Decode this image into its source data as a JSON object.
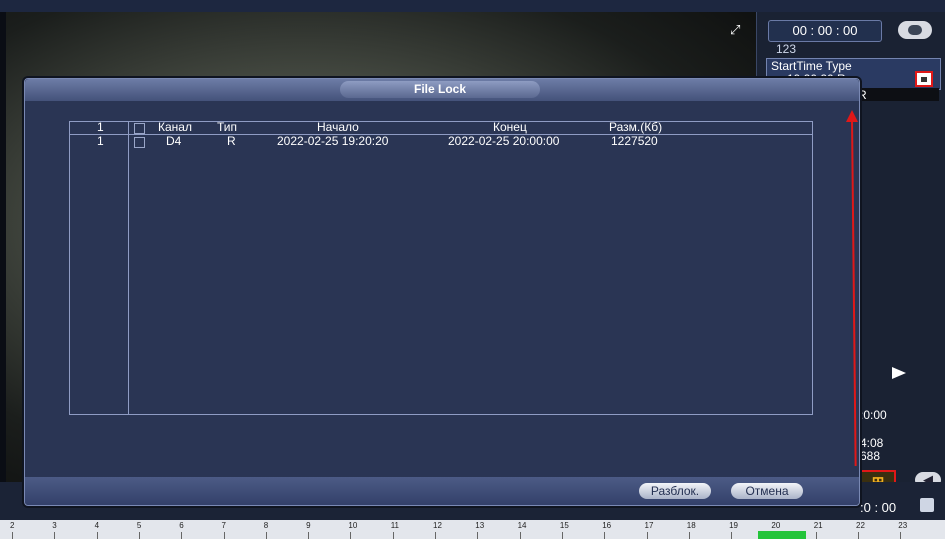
{
  "dialog": {
    "title": "File Lock",
    "table": {
      "index_header": "1",
      "columns": [
        "Канал",
        "Тип",
        "Начало",
        "Конец",
        "Разм.(Кб)"
      ],
      "rows": [
        {
          "index": "1",
          "channel": "D4",
          "type": "R",
          "start": "2022-02-25 19:20:20",
          "end": "2022-02-25 20:00:00",
          "size": "1227520"
        }
      ]
    },
    "buttons": {
      "unlock": "Разблок.",
      "cancel": "Отмена"
    }
  },
  "right_panel": {
    "time_value": "00  :  00  :  00",
    "search_value": "123",
    "list_header": "StartTime Type",
    "partial_entry": "19:20:20 R",
    "selected_row_type": "R",
    "fragment_1": ":0:00",
    "fragment_2": "4:08",
    "fragment_3": "688",
    "time_end": ":0 : 00"
  },
  "timeline": {
    "hours": [
      "2",
      "3",
      "4",
      "5",
      "6",
      "7",
      "8",
      "9",
      "10",
      "11",
      "12",
      "13",
      "14",
      "15",
      "16",
      "17",
      "18",
      "19",
      "20",
      "21",
      "22",
      "23"
    ]
  },
  "icons": {
    "fullscreen": "fullscreen-icon",
    "lock": "lock-icon",
    "play": "play-icon",
    "file_export": "file-export-icon",
    "back": "back-arrow-icon",
    "save": "save-icon",
    "annotation": "red-arrow"
  },
  "colors": {
    "dialog_bg": "#2a3554",
    "annotation_red": "#e01818",
    "record_green": "#24c43a"
  }
}
